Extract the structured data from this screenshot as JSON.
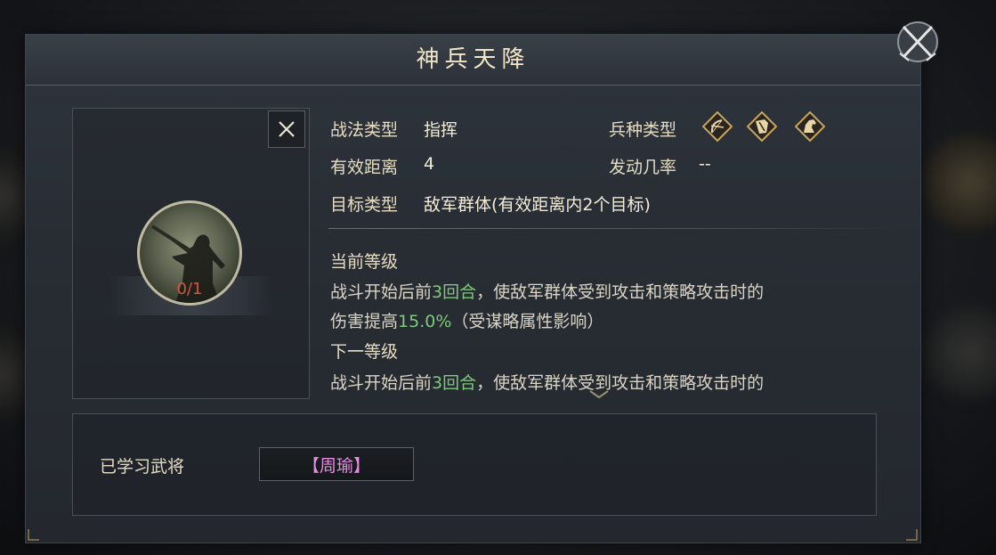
{
  "dialog": {
    "title": "神兵天降"
  },
  "skill": {
    "type_label": "战法类型",
    "type_value": "指挥",
    "range_label": "有效距离",
    "range_value": "4",
    "target_label": "目标类型",
    "target_value": "敌军群体(有效距离内2个目标)",
    "troop_label": "兵种类型",
    "troop_icons": [
      "archer-icon",
      "shield-icon",
      "cavalry-icon"
    ],
    "rate_label": "发动几率",
    "rate_value": "--",
    "level_progress": "0/1"
  },
  "current_level": {
    "title": "当前等级",
    "line1_pre": "战斗开始后前",
    "line1_highlight": "3回合",
    "line1_post": "，使敌军群体受到攻击和策略攻击时的",
    "line2_pre": "伤害提高",
    "line2_highlight": "15.0%",
    "line2_post": "（受谋略属性影响）"
  },
  "next_level": {
    "title": "下一等级",
    "line1_pre": "战斗开始后前",
    "line1_highlight": "3回合",
    "line1_post": "，使敌军群体受到攻击和策略攻击时的"
  },
  "learned": {
    "label": "已学习武将",
    "general": "【周瑜】"
  },
  "colors": {
    "highlight": "#7fc97a",
    "general_name": "#e38ee0",
    "gold": "#c9a55a"
  }
}
